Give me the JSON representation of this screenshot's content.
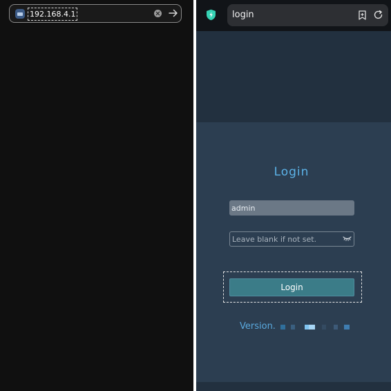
{
  "left_browser": {
    "address_bar_text": "192.168.4.1",
    "site_icon": "router-icon",
    "clear_icon": "clear-circle-icon",
    "go_icon": "arrow-right-icon"
  },
  "right_browser": {
    "security_icon": "shield-icon",
    "address_bar_text": "login",
    "bookmark_icon": "bookmark-add-icon",
    "reload_icon": "reload-icon"
  },
  "login_page": {
    "title": "Login",
    "username_value": "admin",
    "password_placeholder": "Leave blank if not set.",
    "password_toggle_icon": "eye-closed-icon",
    "login_button_label": "Login",
    "version_label": "Version."
  },
  "colors": {
    "left_background": "#101010",
    "page_background": "#2c3e51",
    "accent_blue": "#5cb3e8",
    "button_teal": "#3b7c88"
  }
}
